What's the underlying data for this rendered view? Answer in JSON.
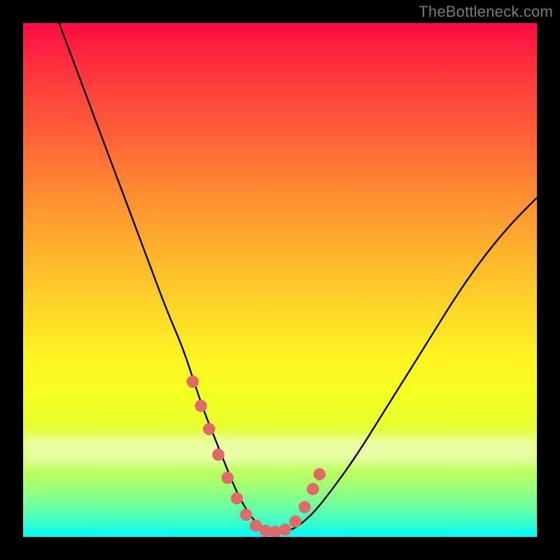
{
  "watermark": {
    "text": "TheBottleneck.com"
  },
  "colors": {
    "curve_stroke": "#000000",
    "dot_fill": "#e06969",
    "background_black": "#000000"
  },
  "chart_data": {
    "type": "line",
    "title": "",
    "xlabel": "",
    "ylabel": "",
    "xlim": [
      0,
      100
    ],
    "ylim": [
      0,
      100
    ],
    "grid": false,
    "legend": false,
    "series": [
      {
        "name": "bottleneck-curve",
        "x": [
          7,
          10,
          13,
          16,
          19,
          22,
          25,
          28,
          31,
          33,
          35,
          37,
          39,
          41,
          43,
          45,
          48,
          52,
          56,
          60,
          65,
          70,
          75,
          80,
          85,
          90,
          95,
          100
        ],
        "y": [
          100,
          92,
          84,
          76,
          68,
          60,
          52,
          44,
          37,
          31,
          25,
          20,
          15,
          10,
          6,
          3,
          1,
          1,
          4,
          9,
          16,
          24,
          32,
          40,
          48,
          55,
          61,
          66
        ]
      }
    ],
    "highlight_points": {
      "name": "highlight-dots",
      "x": [
        33.0,
        34.6,
        36.2,
        38.0,
        39.8,
        41.6,
        43.4,
        45.3,
        47.2,
        49.0,
        51.0,
        53.0,
        54.8,
        56.4,
        57.7
      ],
      "y": [
        30.2,
        25.5,
        21.0,
        16.0,
        11.5,
        7.5,
        4.3,
        2.2,
        1.2,
        1.0,
        1.4,
        3.0,
        5.8,
        9.3,
        12.2
      ]
    }
  }
}
